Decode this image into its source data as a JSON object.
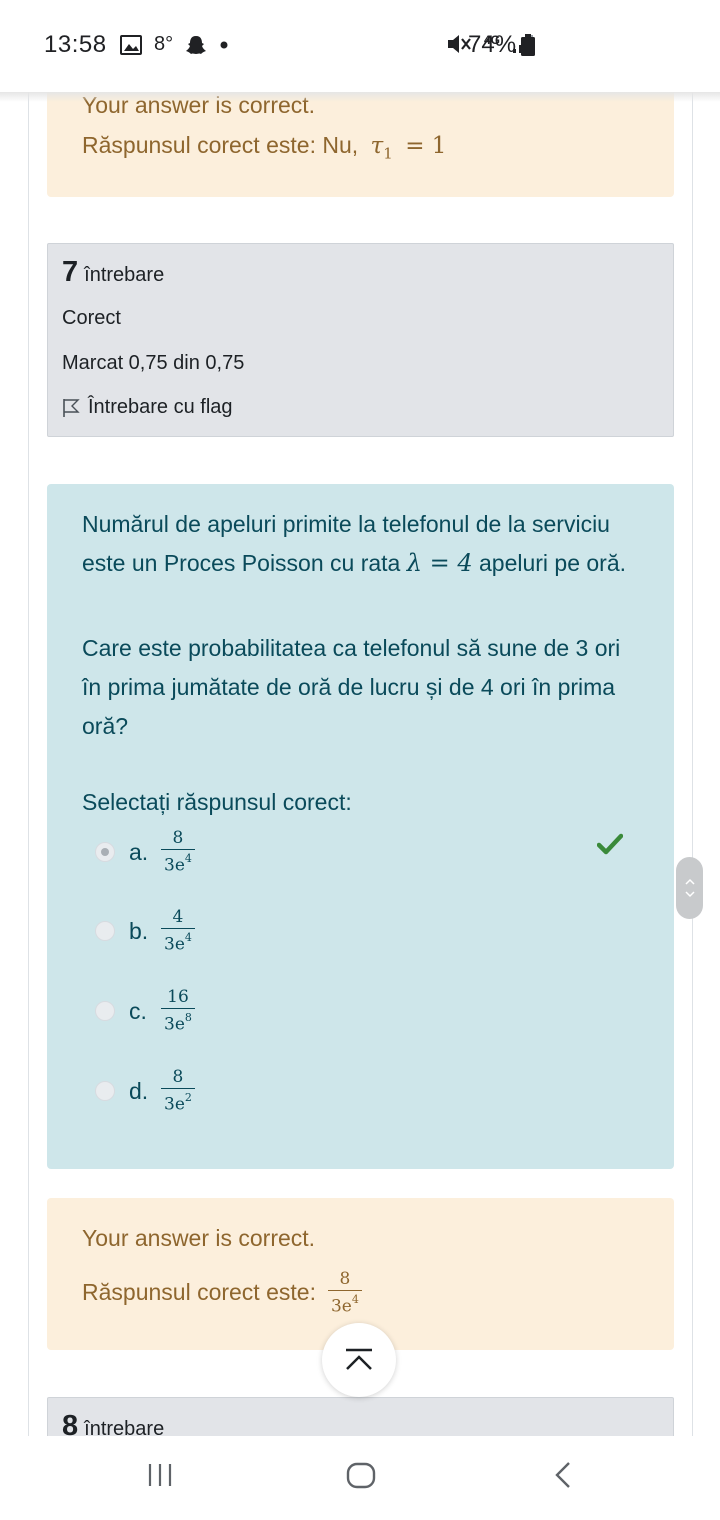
{
  "status_bar": {
    "time": "13:58",
    "temperature": "8°",
    "network": "4G",
    "battery": "74%"
  },
  "prev_question": {
    "feedback_partial": "Your answer is correct.",
    "right_answer_prefix": "Răspunsul corect este: Nu,",
    "right_answer_math_var": "τ",
    "right_answer_math_sub": "1",
    "right_answer_math_rest": "= 1"
  },
  "question7": {
    "number": "7",
    "number_label": "întrebare",
    "state": "Corect",
    "grade": "Marcat 0,75 din 0,75",
    "flag_label": "Întrebare cu flag",
    "text_1": "Numărul de apeluri primite la telefonul de la serviciu este un Proces Poisson cu rata",
    "text_1_math": "λ = 4",
    "text_1_end": "apeluri pe oră.",
    "text_2": "Care este probabilitatea ca telefonul să sune de 3 ori în prima jumătate de oră de lucru și de 4 ori în prima oră?",
    "prompt": "Selectați răspunsul corect:",
    "options": [
      {
        "letter": "a.",
        "num": "8",
        "den_base": "3e",
        "den_exp": "4",
        "checked": true,
        "correct": true
      },
      {
        "letter": "b.",
        "num": "4",
        "den_base": "3e",
        "den_exp": "4",
        "checked": false
      },
      {
        "letter": "c.",
        "num": "16",
        "den_base": "3e",
        "den_exp": "8",
        "checked": false
      },
      {
        "letter": "d.",
        "num": "8",
        "den_base": "3e",
        "den_exp": "2",
        "checked": false
      }
    ],
    "feedback": "Your answer is correct.",
    "right_answer_prefix": "Răspunsul corect este:",
    "right_answer": {
      "num": "8",
      "den_base": "3e",
      "den_exp": "4"
    }
  },
  "question8": {
    "number": "8",
    "number_label": "întrebare"
  },
  "colors": {
    "outcome_bg": "#fcefdc",
    "outcome_text": "#8e662e",
    "formulation_bg": "#cee6ea",
    "formulation_text": "#0a4a5a",
    "info_bg": "#e2e4e8",
    "check_green": "#3a8a3a"
  },
  "icons": {
    "check": "check-icon",
    "flag": "flag-outline-icon",
    "scroll_top": "arrow-up-to-top-icon",
    "nav_recent": "recent-apps-icon",
    "nav_home": "home-icon",
    "nav_back": "back-icon"
  }
}
